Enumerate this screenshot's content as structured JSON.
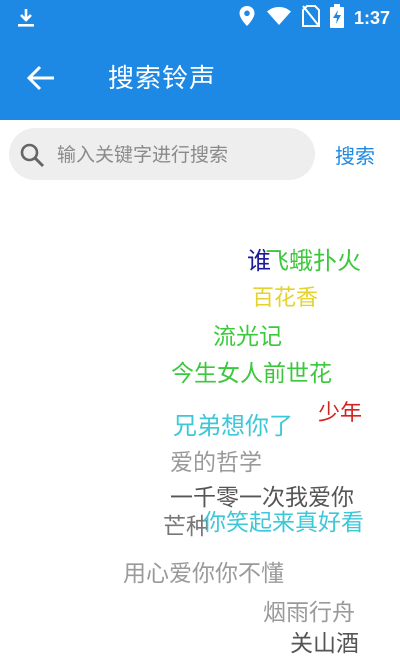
{
  "status_bar": {
    "time": "1:37"
  },
  "app_bar": {
    "title": "搜索铃声"
  },
  "search": {
    "placeholder": "输入关键字进行搜索",
    "button_label": "搜索"
  },
  "tags": [
    {
      "text": "谁",
      "color": "#1a1a9a"
    },
    {
      "text": "飞蛾扑火",
      "color": "#3cc83c"
    },
    {
      "text": "百花香",
      "color": "#e6d22a"
    },
    {
      "text": "流光记",
      "color": "#3cc83c"
    },
    {
      "text": "今生女人前世花",
      "color": "#3cc83c"
    },
    {
      "text": "少年",
      "color": "#d42222"
    },
    {
      "text": "兄弟想你了",
      "color": "#3cc8d8"
    },
    {
      "text": "爱的哲学",
      "color": "#9a9a9a"
    },
    {
      "text": "一千零一次我爱你",
      "color": "#555555"
    },
    {
      "text": "芒种",
      "color": "#777777"
    },
    {
      "text": "你笑起来真好看",
      "color": "#3cc8d8"
    },
    {
      "text": "用心爱你你不懂",
      "color": "#9a9a9a"
    },
    {
      "text": "烟雨行舟",
      "color": "#9a9a9a"
    },
    {
      "text": "关山酒",
      "color": "#555555"
    }
  ]
}
